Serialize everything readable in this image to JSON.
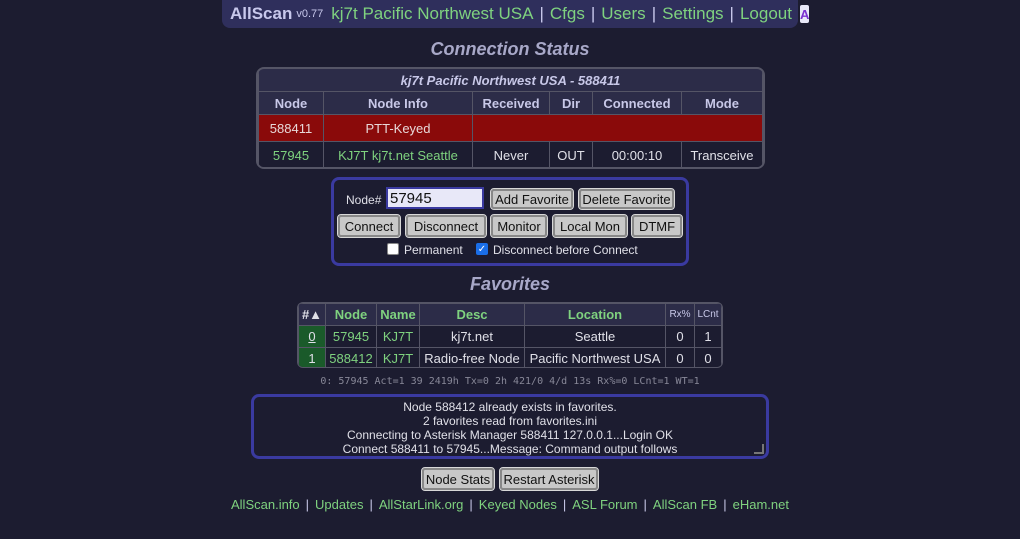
{
  "topbar": {
    "app_name": "AllScan",
    "version": "v0.77",
    "location": "kj7t Pacific Northwest USA",
    "links": [
      "Cfgs",
      "Users",
      "Settings",
      "Logout"
    ],
    "logo_text": "A"
  },
  "connection_status": {
    "title": "Connection Status",
    "caption": "kj7t Pacific Northwest USA - 588411",
    "headers": [
      "Node",
      "Node Info",
      "Received",
      "Dir",
      "Connected",
      "Mode"
    ],
    "keyed_row": {
      "node": "588411",
      "info": "PTT-Keyed"
    },
    "rows": [
      {
        "node": "57945",
        "info": "KJ7T kj7t.net Seattle",
        "received": "Never",
        "dir": "OUT",
        "connected": "00:00:10",
        "mode": "Transceive"
      }
    ]
  },
  "controls": {
    "node_label": "Node#",
    "node_value": "57945",
    "add_favorite": "Add Favorite",
    "delete_favorite": "Delete Favorite",
    "connect": "Connect",
    "disconnect": "Disconnect",
    "monitor": "Monitor",
    "local_mon": "Local Mon",
    "dtmf": "DTMF",
    "permanent_label": "Permanent",
    "permanent_checked": false,
    "disconnect_before_label": "Disconnect before Connect",
    "disconnect_before_checked": true
  },
  "favorites": {
    "title": "Favorites",
    "headers": [
      "#▲",
      "Node",
      "Name",
      "Desc",
      "Location",
      "Rx%",
      "LCnt"
    ],
    "rows": [
      {
        "idx": "0",
        "node": "57945",
        "name": "KJ7T",
        "desc": "kj7t.net",
        "location": "Seattle",
        "rx": "0",
        "lcnt": "1"
      },
      {
        "idx": "1",
        "node": "588412",
        "name": "KJ7T",
        "desc": "Radio-free Node",
        "location": "Pacific Northwest USA",
        "rx": "0",
        "lcnt": "0"
      }
    ]
  },
  "status_line": "0: 57945 Act=1 39 2419h Tx=0 2h 421/0 4/d 13s Rx%=0 LCnt=1 WT=1",
  "log_lines": [
    "Node 588412 already exists in favorites.",
    "2 favorites read from favorites.ini",
    "Connecting to Asterisk Manager 588411 127.0.0.1...Login OK",
    "Connect 588411 to 57945...Message: Command output follows"
  ],
  "bottom_buttons": {
    "node_stats": "Node Stats",
    "restart_asterisk": "Restart Asterisk"
  },
  "footer_links": [
    "AllScan.info",
    "Updates",
    "AllStarLink.org",
    "Keyed Nodes",
    "ASL Forum",
    "AllScan FB",
    "eHam.net"
  ]
}
